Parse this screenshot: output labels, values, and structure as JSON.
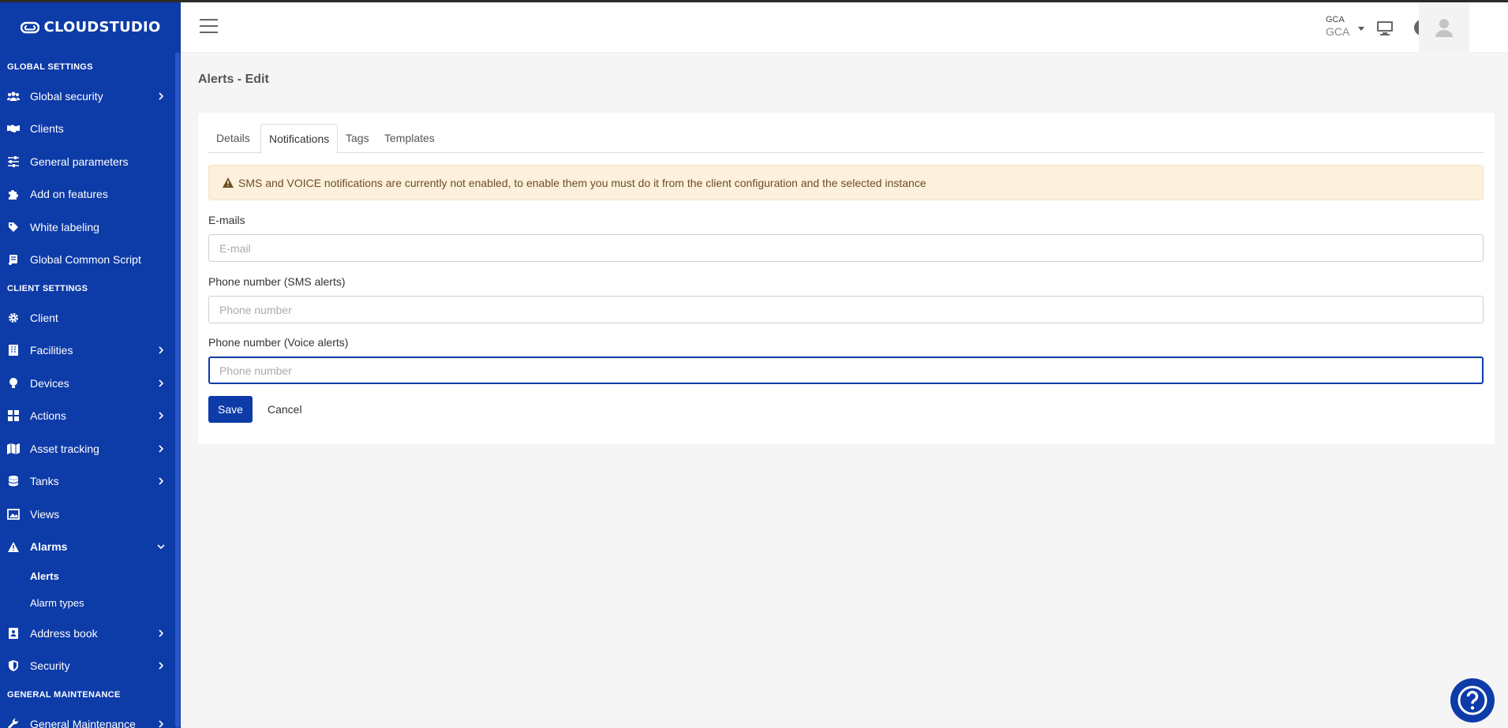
{
  "brand": {
    "name": "CLOUDSTUDIO"
  },
  "sidebar": {
    "sections": {
      "global": "GLOBAL SETTINGS",
      "client": "CLIENT SETTINGS",
      "maintenance": "GENERAL MAINTENANCE"
    },
    "global_items": [
      {
        "label": "Global security",
        "icon": "users-icon",
        "has_children": true
      },
      {
        "label": "Clients",
        "icon": "handshake-icon",
        "has_children": false
      },
      {
        "label": "General parameters",
        "icon": "sliders-icon",
        "has_children": false
      },
      {
        "label": "Add on features",
        "icon": "puzzle-icon",
        "has_children": false
      },
      {
        "label": "White labeling",
        "icon": "tag-icon",
        "has_children": false
      },
      {
        "label": "Global Common Script",
        "icon": "scroll-icon",
        "has_children": false
      }
    ],
    "client_items": [
      {
        "label": "Client",
        "icon": "gear-icon",
        "has_children": false
      },
      {
        "label": "Facilities",
        "icon": "building-icon",
        "has_children": true
      },
      {
        "label": "Devices",
        "icon": "lightbulb-icon",
        "has_children": true
      },
      {
        "label": "Actions",
        "icon": "grid-icon",
        "has_children": true
      },
      {
        "label": "Asset tracking",
        "icon": "map-icon",
        "has_children": true
      },
      {
        "label": "Tanks",
        "icon": "database-icon",
        "has_children": true
      },
      {
        "label": "Views",
        "icon": "image-icon",
        "has_children": false
      },
      {
        "label": "Alarms",
        "icon": "warning-icon",
        "has_children": true,
        "expanded": true
      }
    ],
    "alarms_sub": [
      {
        "label": "Alerts",
        "active": true
      },
      {
        "label": "Alarm types",
        "active": false
      }
    ],
    "client_items_after": [
      {
        "label": "Address book",
        "icon": "address-book-icon",
        "has_children": true
      },
      {
        "label": "Security",
        "icon": "shield-icon",
        "has_children": true
      }
    ],
    "maintenance_items": [
      {
        "label": "General Maintenance",
        "icon": "wrench-icon",
        "has_children": true
      }
    ]
  },
  "topbar": {
    "org_code": "GCA",
    "org_name": "GCA",
    "icons": [
      "monitor-icon",
      "help-icon",
      "user-avatar-icon"
    ]
  },
  "page": {
    "title": "Alerts - Edit",
    "tabs": [
      {
        "label": "Details",
        "active": false
      },
      {
        "label": "Notifications",
        "active": true
      },
      {
        "label": "Tags",
        "active": false
      },
      {
        "label": "Templates",
        "active": false
      }
    ],
    "alert_message": "SMS and VOICE notifications are currently not enabled, to enable them you must do it from the client configuration and the selected instance",
    "fields": {
      "emails": {
        "label": "E-mails",
        "placeholder": "E-mail",
        "value": ""
      },
      "sms": {
        "label": "Phone number (SMS alerts)",
        "placeholder": "Phone number",
        "value": ""
      },
      "voice": {
        "label": "Phone number (Voice alerts)",
        "placeholder": "Phone number",
        "value": ""
      }
    },
    "save_label": "Save",
    "cancel_label": "Cancel"
  },
  "colors": {
    "primary": "#0d3ba8",
    "alert_bg": "#fdf0dc",
    "alert_text": "#6b4f24"
  }
}
